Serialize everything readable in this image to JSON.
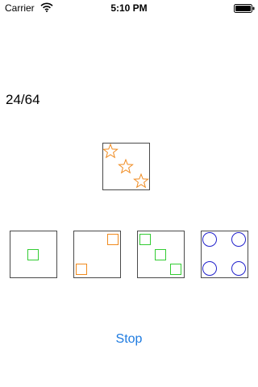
{
  "status_bar": {
    "carrier": "Carrier",
    "time": "5:10 PM",
    "wifi_icon": "wifi-icon",
    "battery_icon": "battery-icon"
  },
  "game": {
    "progress": "24/64",
    "target_card": {
      "shape": "star",
      "count": 3,
      "color": "#f08a1e"
    },
    "choices": [
      {
        "shape": "square",
        "count": 1,
        "color": "#33cc33"
      },
      {
        "shape": "square",
        "count": 2,
        "color": "#f08a1e"
      },
      {
        "shape": "square",
        "count": 3,
        "color": "#33cc33"
      },
      {
        "shape": "circle",
        "count": 4,
        "color": "#2222cc"
      }
    ]
  },
  "controls": {
    "stop_label": "Stop",
    "accent_color": "#1e7be0"
  }
}
